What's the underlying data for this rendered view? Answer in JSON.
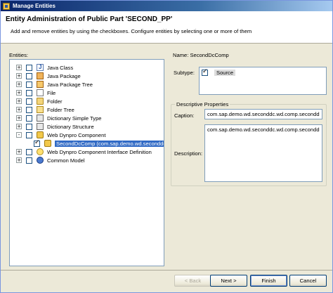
{
  "window": {
    "title": "Manage Entities"
  },
  "header": {
    "title": "Entity Administration of Public Part 'SECOND_PP'",
    "description": "Add and remove entities by using the checkboxes. Configure entities by selecting one or more of them"
  },
  "entities": {
    "label": "Entities:",
    "tree": [
      {
        "label": "Java Class",
        "expander": "+",
        "checked": false,
        "icon": "java-class-icon"
      },
      {
        "label": "Java Package",
        "expander": "+",
        "checked": false,
        "icon": "java-package-icon"
      },
      {
        "label": "Java Package Tree",
        "expander": "+",
        "checked": false,
        "icon": "java-package-tree-icon"
      },
      {
        "label": "File",
        "expander": "+",
        "checked": false,
        "icon": "file-icon"
      },
      {
        "label": "Folder",
        "expander": "+",
        "checked": false,
        "icon": "folder-icon"
      },
      {
        "label": "Folder Tree",
        "expander": "+",
        "checked": false,
        "icon": "folder-tree-icon"
      },
      {
        "label": "Dictionary Simple Type",
        "expander": "+",
        "checked": false,
        "icon": "dictionary-simple-type-icon"
      },
      {
        "label": "Dictionary Structure",
        "expander": "+",
        "checked": false,
        "icon": "dictionary-structure-icon"
      },
      {
        "label": "Web Dynpro Component",
        "expander": "-",
        "checked": false,
        "icon": "web-dynpro-component-icon"
      },
      {
        "label": "SecondDcComp (com.sap.demo.wd.seconddc",
        "expander": "",
        "checked": true,
        "icon": "web-dynpro-component-icon",
        "selected": true,
        "child": true
      },
      {
        "label": "Web Dynpro Component Interface Definition",
        "expander": "+",
        "checked": false,
        "icon": "component-interface-icon"
      },
      {
        "label": "Common Model",
        "expander": "+",
        "checked": false,
        "icon": "common-model-icon"
      }
    ]
  },
  "details": {
    "name_label": "Name: SecondDcComp",
    "subtype_label": "Subtype:",
    "subtype_items": [
      {
        "label": "Source",
        "checked": true
      }
    ],
    "group_title": "Descriptive Properties",
    "caption_label": "Caption:",
    "caption_value": "com.sap.demo.wd.seconddc.wd.comp.secondd",
    "description_label": "Description:",
    "description_value": "com.sap.demo.wd.seconddc.wd.comp.secondd"
  },
  "buttons": {
    "back": "< Back",
    "next": "Next >",
    "finish": "Finish",
    "cancel": "Cancel"
  }
}
